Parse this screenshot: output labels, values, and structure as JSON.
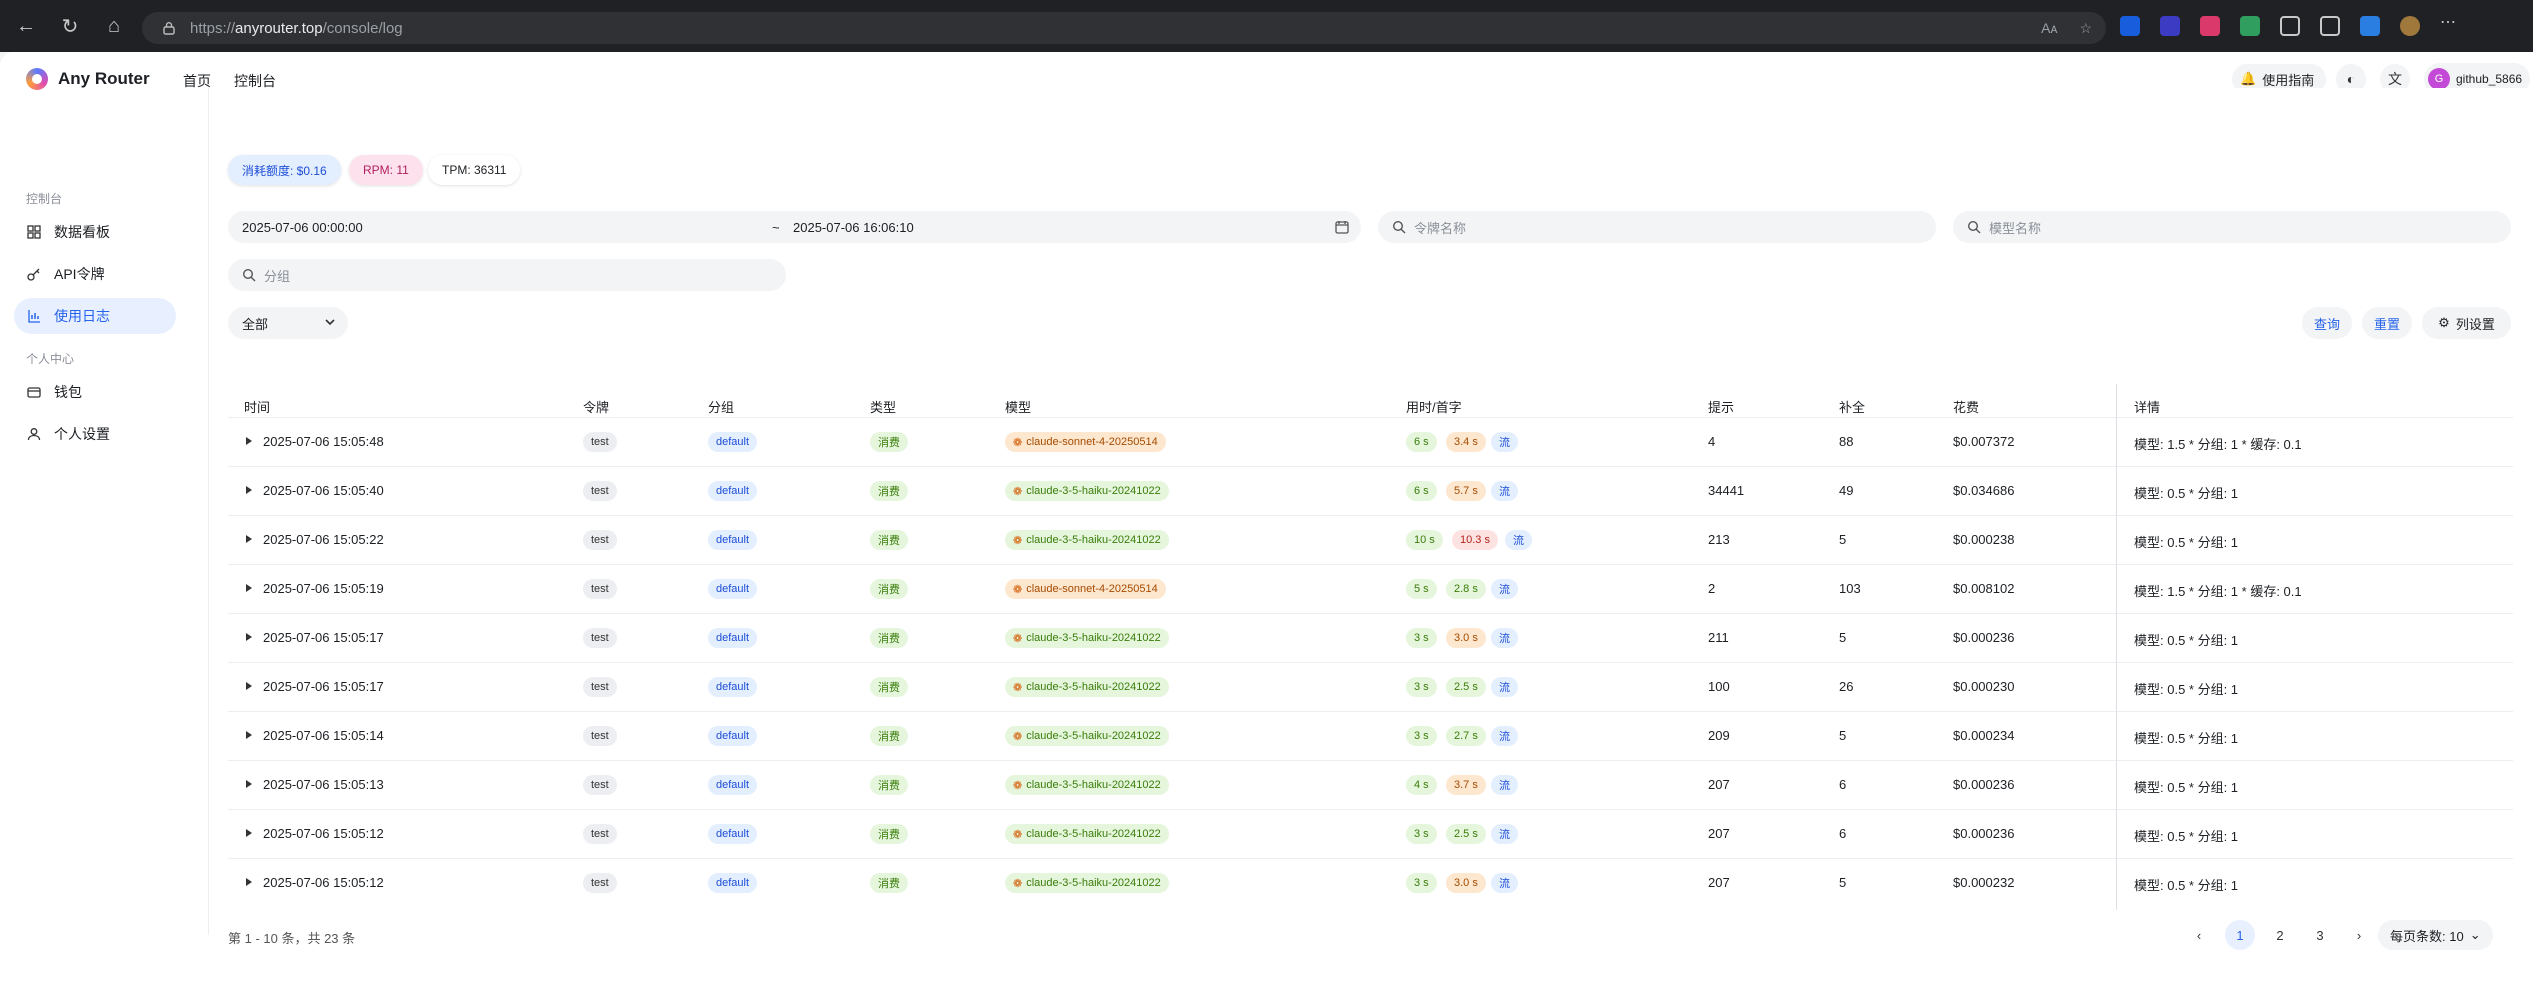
{
  "browser": {
    "url_prefix": "https://",
    "url_host": "anyrouter.top",
    "url_path": "/console/log"
  },
  "header": {
    "brand": "Any Router",
    "nav": [
      "首页",
      "控制台"
    ],
    "guide_label": "使用指南",
    "username": "github_5866",
    "avatar_letter": "G"
  },
  "sidebar": {
    "section_console": "控制台",
    "section_personal": "个人中心",
    "items": [
      {
        "label": "数据看板",
        "icon": "grid-icon"
      },
      {
        "label": "API令牌",
        "icon": "key-icon"
      },
      {
        "label": "使用日志",
        "icon": "chart-icon"
      },
      {
        "label": "钱包",
        "icon": "wallet-icon"
      },
      {
        "label": "个人设置",
        "icon": "user-icon"
      }
    ]
  },
  "stats": {
    "quota": "消耗额度: $0.16",
    "rpm": "RPM: 11",
    "tpm": "TPM: 36311"
  },
  "filters": {
    "date_start": "2025-07-06 00:00:00",
    "date_sep": "~",
    "date_end": "2025-07-06 16:06:10",
    "token_placeholder": "令牌名称",
    "model_placeholder": "模型名称",
    "group_placeholder": "分组",
    "type_select": "全部",
    "query_label": "查询",
    "reset_label": "重置",
    "columns_label": "列设置"
  },
  "table": {
    "columns": [
      "时间",
      "令牌",
      "分组",
      "类型",
      "模型",
      "用时/首字",
      "提示",
      "补全",
      "花费",
      "详情"
    ],
    "rows": [
      {
        "time": "2025-07-06 15:05:48",
        "token": "test",
        "group": "default",
        "type": "消费",
        "model": "claude-sonnet-4-20250514",
        "model_color": "orange",
        "use_time": "6 s",
        "first": "3.4 s",
        "first_color": "orange",
        "stream": "流",
        "prompt": "4",
        "completion": "88",
        "cost": "$0.007372",
        "detail": "模型: 1.5 * 分组: 1 * 缓存: 0.1"
      },
      {
        "time": "2025-07-06 15:05:40",
        "token": "test",
        "group": "default",
        "type": "消费",
        "model": "claude-3-5-haiku-20241022",
        "model_color": "green",
        "use_time": "6 s",
        "first": "5.7 s",
        "first_color": "orange",
        "stream": "流",
        "prompt": "34441",
        "completion": "49",
        "cost": "$0.034686",
        "detail": "模型: 0.5 * 分组: 1"
      },
      {
        "time": "2025-07-06 15:05:22",
        "token": "test",
        "group": "default",
        "type": "消费",
        "model": "claude-3-5-haiku-20241022",
        "model_color": "green",
        "use_time": "10 s",
        "first": "10.3 s",
        "first_color": "red",
        "stream": "流",
        "prompt": "213",
        "completion": "5",
        "cost": "$0.000238",
        "detail": "模型: 0.5 * 分组: 1"
      },
      {
        "time": "2025-07-06 15:05:19",
        "token": "test",
        "group": "default",
        "type": "消费",
        "model": "claude-sonnet-4-20250514",
        "model_color": "orange",
        "use_time": "5 s",
        "first": "2.8 s",
        "first_color": "green",
        "stream": "流",
        "prompt": "2",
        "completion": "103",
        "cost": "$0.008102",
        "detail": "模型: 1.5 * 分组: 1 * 缓存: 0.1"
      },
      {
        "time": "2025-07-06 15:05:17",
        "token": "test",
        "group": "default",
        "type": "消费",
        "model": "claude-3-5-haiku-20241022",
        "model_color": "green",
        "use_time": "3 s",
        "first": "3.0 s",
        "first_color": "orange",
        "stream": "流",
        "prompt": "211",
        "completion": "5",
        "cost": "$0.000236",
        "detail": "模型: 0.5 * 分组: 1"
      },
      {
        "time": "2025-07-06 15:05:17",
        "token": "test",
        "group": "default",
        "type": "消费",
        "model": "claude-3-5-haiku-20241022",
        "model_color": "green",
        "use_time": "3 s",
        "first": "2.5 s",
        "first_color": "green",
        "stream": "流",
        "prompt": "100",
        "completion": "26",
        "cost": "$0.000230",
        "detail": "模型: 0.5 * 分组: 1"
      },
      {
        "time": "2025-07-06 15:05:14",
        "token": "test",
        "group": "default",
        "type": "消费",
        "model": "claude-3-5-haiku-20241022",
        "model_color": "green",
        "use_time": "3 s",
        "first": "2.7 s",
        "first_color": "green",
        "stream": "流",
        "prompt": "209",
        "completion": "5",
        "cost": "$0.000234",
        "detail": "模型: 0.5 * 分组: 1"
      },
      {
        "time": "2025-07-06 15:05:13",
        "token": "test",
        "group": "default",
        "type": "消费",
        "model": "claude-3-5-haiku-20241022",
        "model_color": "green",
        "use_time": "4 s",
        "first": "3.7 s",
        "first_color": "orange",
        "stream": "流",
        "prompt": "207",
        "completion": "6",
        "cost": "$0.000236",
        "detail": "模型: 0.5 * 分组: 1"
      },
      {
        "time": "2025-07-06 15:05:12",
        "token": "test",
        "group": "default",
        "type": "消费",
        "model": "claude-3-5-haiku-20241022",
        "model_color": "green",
        "use_time": "3 s",
        "first": "2.5 s",
        "first_color": "green",
        "stream": "流",
        "prompt": "207",
        "completion": "6",
        "cost": "$0.000236",
        "detail": "模型: 0.5 * 分组: 1"
      },
      {
        "time": "2025-07-06 15:05:12",
        "token": "test",
        "group": "default",
        "type": "消费",
        "model": "claude-3-5-haiku-20241022",
        "model_color": "green",
        "use_time": "3 s",
        "first": "3.0 s",
        "first_color": "orange",
        "stream": "流",
        "prompt": "207",
        "completion": "5",
        "cost": "$0.000232",
        "detail": "模型: 0.5 * 分组: 1"
      }
    ]
  },
  "pagination": {
    "info": "第 1 - 10 条，共 23 条",
    "pages": [
      "1",
      "2",
      "3"
    ],
    "current": "1",
    "page_size_label": "每页条数: 10"
  },
  "colors": {
    "accent": "#2563eb",
    "active_bg": "#e8f0ff"
  }
}
